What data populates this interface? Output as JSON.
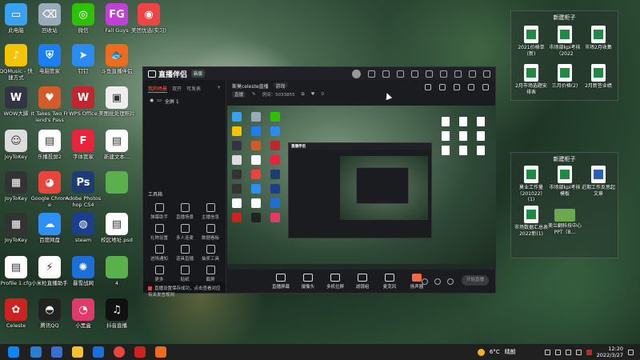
{
  "desktop_icons": [
    {
      "label": "此电脑",
      "color": "#3aa0f0",
      "glyph": "▭",
      "col": 0,
      "row": 0
    },
    {
      "label": "回收站",
      "color": "#9ab",
      "glyph": "⌫",
      "col": 1,
      "row": 0
    },
    {
      "label": "微信",
      "color": "#2dc100",
      "glyph": "◎",
      "col": 2,
      "row": 0
    },
    {
      "label": "Fall Guys",
      "color": "#c23fd6",
      "glyph": "FG",
      "col": 3,
      "row": 0
    },
    {
      "label": "美团优选(实习)",
      "color": "#e44",
      "glyph": "◉",
      "col": 4,
      "row": 0
    },
    {
      "label": "QQMusic - 快捷方式",
      "color": "#f5c400",
      "glyph": "♪",
      "col": 0,
      "row": 1
    },
    {
      "label": "电脑管家",
      "color": "#1a7ff0",
      "glyph": "⛨",
      "col": 1,
      "row": 1
    },
    {
      "label": "钉钉",
      "color": "#2a8cf0",
      "glyph": "➤",
      "col": 2,
      "row": 1
    },
    {
      "label": "斗鱼直播伴侣",
      "color": "#f06c1d",
      "glyph": "🐟",
      "col": 3,
      "row": 1
    },
    {
      "label": "WOW大脚",
      "color": "#334",
      "glyph": "W",
      "col": 0,
      "row": 2
    },
    {
      "label": "It Takes Two Friend's Pass",
      "color": "#d35a2a",
      "glyph": "♥",
      "col": 1,
      "row": 2
    },
    {
      "label": "WPS Office",
      "color": "#c0262d",
      "glyph": "W",
      "col": 2,
      "row": 2
    },
    {
      "label": "美图批处理照片",
      "color": "#eee",
      "glyph": "▣",
      "col": 3,
      "row": 2
    },
    {
      "label": "JoyToKey",
      "color": "#ddd",
      "glyph": "☺",
      "col": 0,
      "row": 3
    },
    {
      "label": "乐播投屏2",
      "color": "#fff",
      "glyph": "▤",
      "col": 1,
      "row": 3
    },
    {
      "label": "字体管家",
      "color": "#e8233b",
      "glyph": "F",
      "col": 2,
      "row": 3
    },
    {
      "label": "新建文本...",
      "color": "#fff",
      "glyph": "▤",
      "col": 3,
      "row": 3
    },
    {
      "label": "JoyToKey",
      "color": "#333",
      "glyph": "▦",
      "col": 0,
      "row": 4
    },
    {
      "label": "Google Chrome",
      "color": "#e8453c",
      "glyph": "◕",
      "col": 1,
      "row": 4
    },
    {
      "label": "Adobe Photoshop CS4",
      "color": "#1c3c72",
      "glyph": "Ps",
      "col": 2,
      "row": 4
    },
    {
      "label": "",
      "color": "#5ab04a",
      "glyph": "",
      "col": 3,
      "row": 4
    },
    {
      "label": "JoyToKey",
      "color": "#333",
      "glyph": "▦",
      "col": 0,
      "row": 5
    },
    {
      "label": "百度网盘",
      "color": "#2e8ff5",
      "glyph": "☁",
      "col": 1,
      "row": 5
    },
    {
      "label": "steam",
      "color": "#1b3f8a",
      "glyph": "◍",
      "col": 2,
      "row": 5
    },
    {
      "label": "校区地址.psd",
      "color": "#fff",
      "glyph": "▤",
      "col": 3,
      "row": 5
    },
    {
      "label": "Profile 1.cfg",
      "color": "#fff",
      "glyph": "▤",
      "col": 0,
      "row": 6
    },
    {
      "label": "小米粒直播助手",
      "color": "#fff",
      "glyph": "⚡",
      "col": 1,
      "row": 6
    },
    {
      "label": "暴雪战网",
      "color": "#1d6fd8",
      "glyph": "✺",
      "col": 2,
      "row": 6
    },
    {
      "label": "4",
      "color": "#5ab04a",
      "glyph": "",
      "col": 3,
      "row": 6
    },
    {
      "label": "Celeste",
      "color": "#c22",
      "glyph": "✿",
      "col": 0,
      "row": 7
    },
    {
      "label": "腾讯QQ",
      "color": "#222",
      "glyph": "◓",
      "col": 1,
      "row": 7
    },
    {
      "label": "小黑盒",
      "color": "#e03a6a",
      "glyph": "◔",
      "col": 2,
      "row": 7
    },
    {
      "label": "抖音直播",
      "color": "#111",
      "glyph": "♫",
      "col": 3,
      "row": 7
    }
  ],
  "folder_panel_1": {
    "title": "新建柜子",
    "items": [
      {
        "label": "2021价格单(新)",
        "type": "x"
      },
      {
        "label": "市场部kpi考核（2022",
        "type": "x"
      },
      {
        "label": "市场2月收集",
        "type": "x"
      },
      {
        "label": "2月市场选题安排表",
        "type": "x"
      },
      {
        "label": "三月价格(2)",
        "type": "x"
      },
      {
        "label": "2月新签业绩",
        "type": "x"
      }
    ]
  },
  "folder_panel_2": {
    "title": "新建柜子",
    "items": [
      {
        "label": "莫业工作量（201022）(1)",
        "type": "x"
      },
      {
        "label": "市场部kpi考核模板",
        "type": "x"
      },
      {
        "label": "近期工作反思起文章",
        "type": "w"
      },
      {
        "label": "市场数据汇总表2022新(1)",
        "type": "x"
      },
      {
        "label": "美兰翻科技中心PPT（B...",
        "type": "img"
      }
    ]
  },
  "app": {
    "name": "直播伴侣",
    "version_tag": "新版",
    "scene_tabs": [
      "我的场景",
      "双开",
      "可发表"
    ],
    "scene_add": "+",
    "scene_item": "全屏 1",
    "tools_title": "工具箱",
    "tools": [
      "弹幕助手",
      "直播场景",
      "主播信息",
      "礼物设置",
      "多人连麦",
      "数据看板",
      "进场通知",
      "道具直播",
      "抽奖工具",
      "更多",
      "贴纸",
      "截屏"
    ],
    "notice": "直播设置保存成功，点击查看对应有关发言规则",
    "room_title": "斯莫celeste直播",
    "room_tag": "游戏",
    "room_meta_tag": "直播",
    "room_id": "房间：5033855",
    "room_count": "0",
    "bottom_tools": [
      "直播屏幕",
      "摄像头",
      "多机位屏",
      "滤镜组",
      "麦克风",
      "扬声器"
    ],
    "go_live": "开始直播"
  },
  "taskbar": {
    "temp": "6°C",
    "weather": "晴朗",
    "time": "12:20",
    "date": "2022/3/27"
  }
}
